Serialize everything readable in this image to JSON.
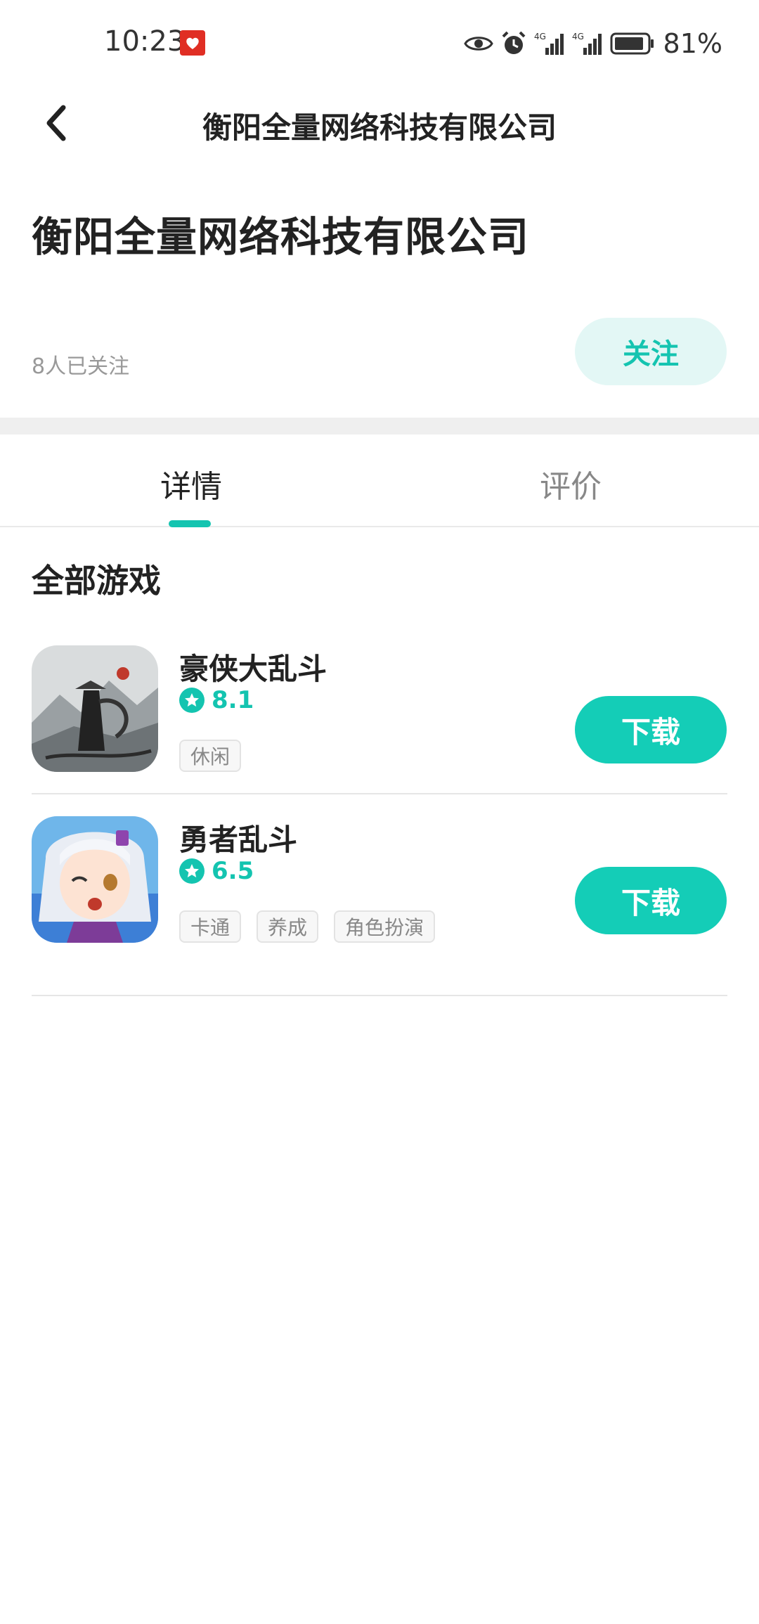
{
  "status_bar": {
    "time": "10:23",
    "app_icon": "pinduoduo-icon",
    "icons": [
      "eye-icon",
      "alarm-icon",
      "signal-4g-icon",
      "signal-4g-icon",
      "battery-icon"
    ],
    "battery": "81%"
  },
  "nav": {
    "back_icon": "chevron-left-icon",
    "title": "衡阳全量网络科技有限公司"
  },
  "company": {
    "name": "衡阳全量网络科技有限公司",
    "followers": "8人已关注",
    "follow_label": "关注"
  },
  "tabs": [
    {
      "label": "详情",
      "active": true
    },
    {
      "label": "评价",
      "active": false
    }
  ],
  "section_title": "全部游戏",
  "games": [
    {
      "name": "豪侠大乱斗",
      "rating": "8.1",
      "tags": [
        "休闲"
      ],
      "download_label": "下载",
      "icon": "ink-swordsman-game-icon"
    },
    {
      "name": "勇者乱斗",
      "rating": "6.5",
      "tags": [
        "卡通",
        "养成",
        "角色扮演"
      ],
      "download_label": "下载",
      "icon": "anime-girl-game-icon"
    }
  ],
  "colors": {
    "accent": "#14c4b0",
    "follow_bg": "#e3f7f5",
    "download_bg": "#14cdb7"
  }
}
